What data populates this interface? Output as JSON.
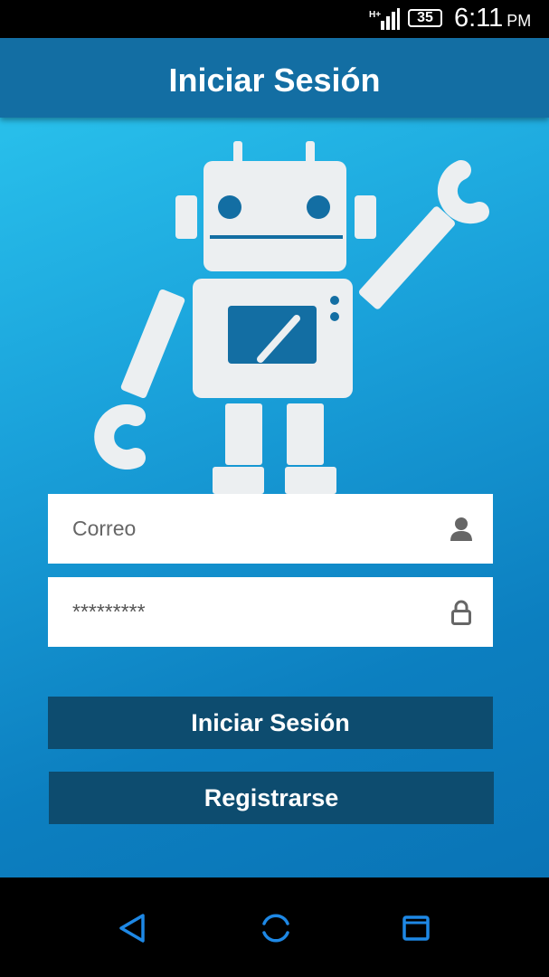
{
  "status_bar": {
    "network": "H+",
    "battery": "35",
    "time": "6:11",
    "ampm": "PM"
  },
  "app_bar": {
    "title": "Iniciar Sesión"
  },
  "login_form": {
    "email_placeholder": "Correo",
    "password_value": "*********",
    "login_button": "Iniciar Sesión",
    "register_button": "Registrarse"
  },
  "icons": {
    "email_field": "user-icon",
    "password_field": "lock-icon",
    "nav": [
      "back-icon",
      "home-icon",
      "recents-icon"
    ]
  },
  "colors": {
    "background_top": "#2cc7ef",
    "background_bottom": "#0a74b6",
    "app_bar": "#136ea3",
    "button": "#0d4c6f",
    "robot": "#eceff1",
    "robot_accent": "#136ea3",
    "nav_icon": "#1e88e5"
  }
}
